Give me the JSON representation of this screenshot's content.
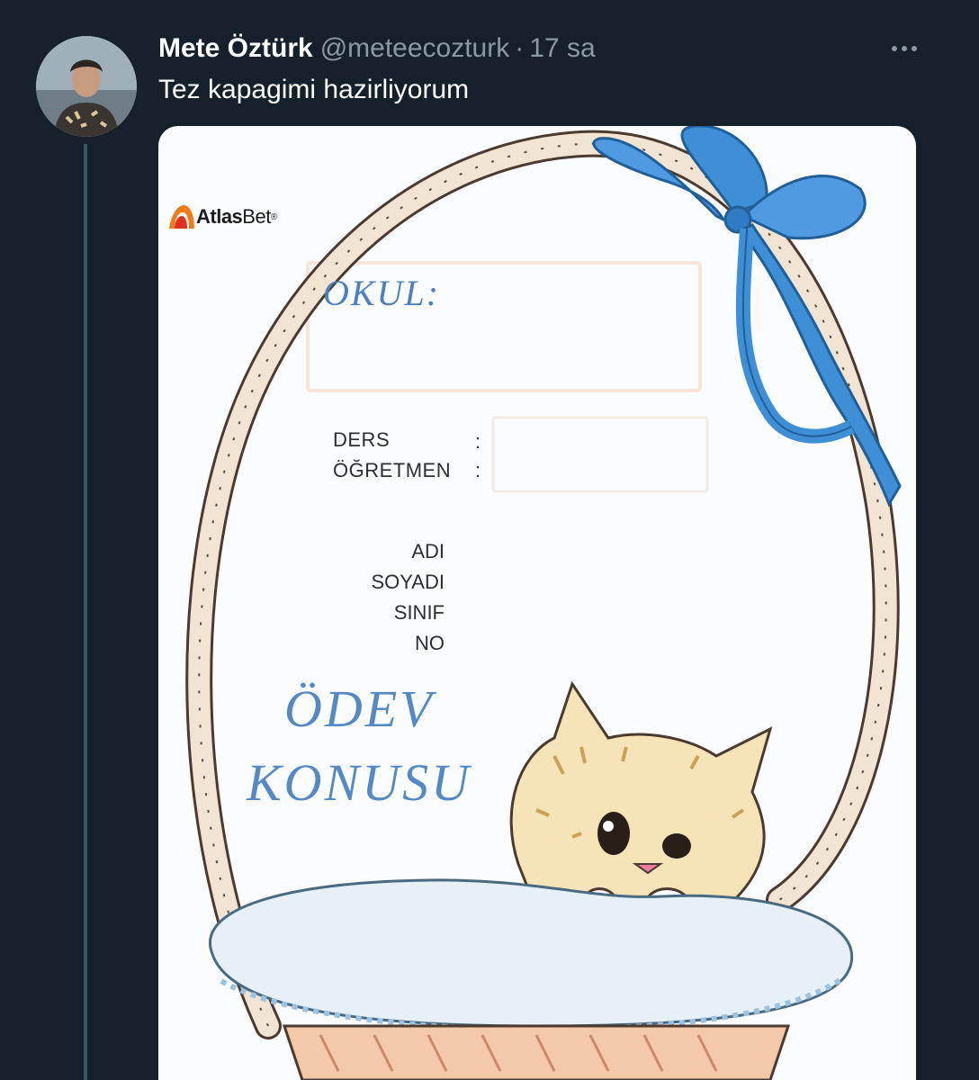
{
  "tweet": {
    "display_name": "Mete Öztürk",
    "handle": "@meteecozturk",
    "separator": "·",
    "time": "17 sa",
    "text": "Tez kapagimi hazirliyorum",
    "more_icon": "more-horizontal-icon",
    "avatar_icon": "profile-photo"
  },
  "media": {
    "watermark": {
      "brand_bold": "Atlas",
      "brand_light": "Bet",
      "registered": "®"
    },
    "cover": {
      "school_label": "OKUL:",
      "course_label": "DERS",
      "teacher_label": "ÖĞRETMEN",
      "colon": ":",
      "name_label": "ADI",
      "surname_label": "SOYADI",
      "class_label": "SINIF",
      "number_label": "NO",
      "homework_word1": "ÖDEV",
      "homework_word2": "KONUSU"
    }
  },
  "colors": {
    "background": "#15202b",
    "muted_text": "#8b98a5",
    "title_blue": "#5489c4",
    "ribbon_blue": "#3f8fd6",
    "brand_orange": "#f07d1a"
  }
}
